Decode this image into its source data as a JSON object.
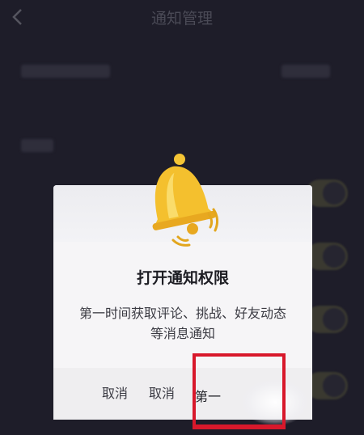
{
  "header": {
    "back_icon": "chevron-left-icon",
    "title": "通知管理"
  },
  "dialog": {
    "icon": "bell-icon",
    "title": "打开通知权限",
    "message": "第一时间获取评论、挑战、好友动态等消息通知",
    "buttons": {
      "cancel_1": "取消",
      "cancel_2": "取消",
      "confirm": "第一"
    }
  },
  "colors": {
    "background": "#1e1d29",
    "dialog_bg": "#f6f5f7",
    "highlight": "#d8182b",
    "bell": "#f5c535"
  }
}
